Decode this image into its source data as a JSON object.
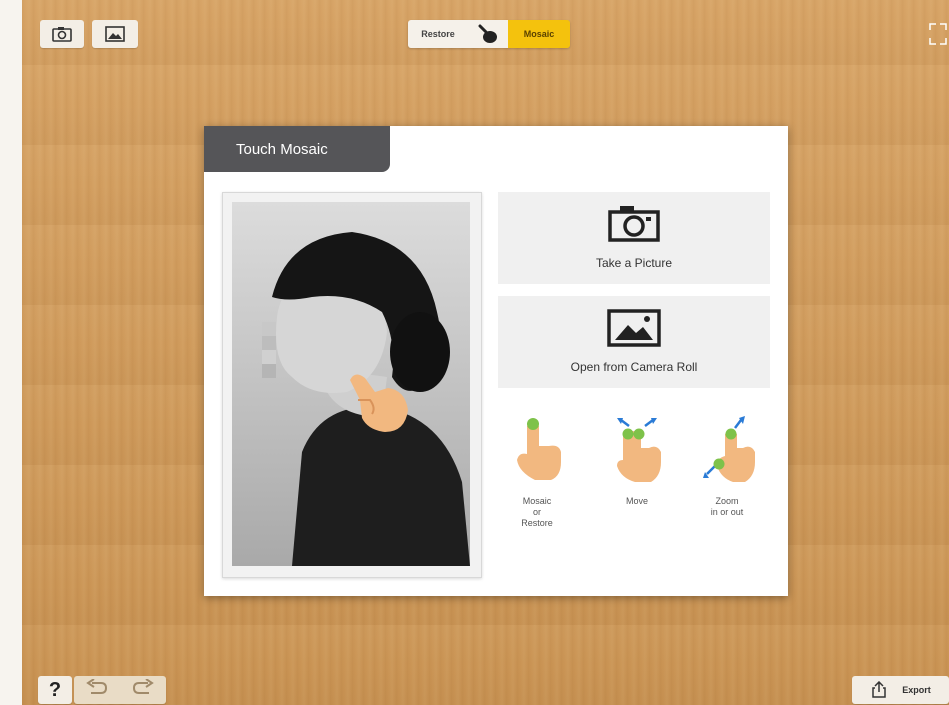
{
  "toolbar": {
    "camera_icon": "camera-icon",
    "photo_icon": "photo-icon",
    "fullscreen_icon": "fullscreen-icon",
    "mode_restore": "Restore",
    "mode_mosaic": "Mosaic",
    "active_mode": "Mosaic",
    "accent_color": "#f4c20d"
  },
  "dialog": {
    "title": "Touch Mosaic",
    "take_picture": "Take a Picture",
    "open_roll": "Open from Camera Roll",
    "gestures": [
      {
        "label": "Mosaic\nor\nRestore",
        "icon": "tap-gesture-icon"
      },
      {
        "label": "Move",
        "icon": "two-finger-drag-icon"
      },
      {
        "label": "Zoom\nin or out",
        "icon": "pinch-zoom-icon"
      }
    ]
  },
  "bottom": {
    "help": "?",
    "undo_icon": "undo-icon",
    "redo_icon": "redo-icon",
    "export": "Export",
    "export_icon": "share-icon"
  }
}
